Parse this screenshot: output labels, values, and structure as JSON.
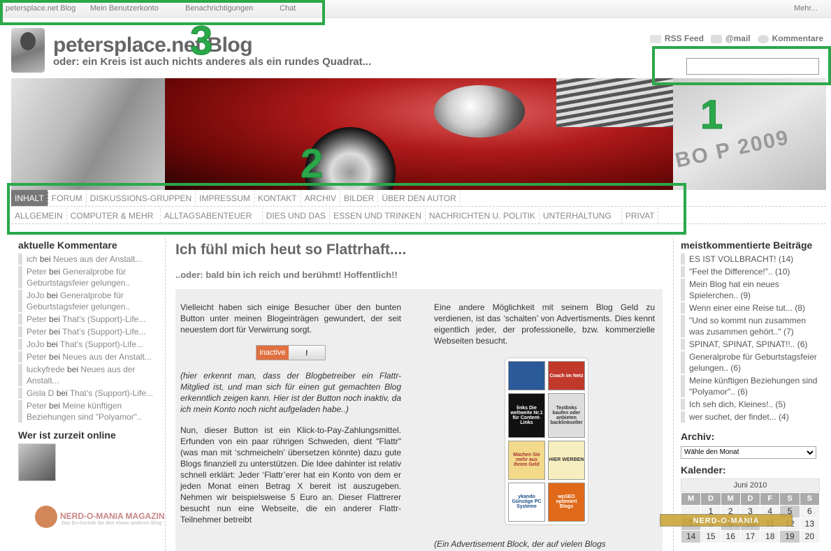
{
  "topbar": {
    "blog_link": "petersplace.net Blog",
    "account": "Mein Benutzerkonto",
    "notifications": "Benachrichtigungen",
    "chat": "Chat",
    "more": "Mehr..."
  },
  "header": {
    "title": "petersplace.net Blog",
    "tagline": "oder: ein Kreis ist auch nichts anderes als ein rundes Quadrat...",
    "rss": "RSS Feed",
    "mail": "@mail",
    "comments": "Kommentare",
    "search_value": ""
  },
  "banner": {
    "plate": "BO P 2009"
  },
  "nav_main": [
    "INHALT",
    "FORUM",
    "DISKUSSIONS-GRUPPEN",
    "IMPRESSUM",
    "KONTAKT",
    "ARCHIV",
    "BILDER",
    "ÜBER DEN AUTOR"
  ],
  "nav_categories": [
    "ALLGEMEIN",
    "COMPUTER & MEHR",
    "ALLTAGSABENTEUER",
    "DIES UND DAS",
    "ESSEN UND TRINKEN",
    "NACHRICHTEN U. POLITIK",
    "UNTERHALTUNG",
    "PRIVAT"
  ],
  "left_sidebar": {
    "heading": "aktuelle Kommentare",
    "comments": [
      {
        "author": "ich",
        "by": "bei",
        "post": "Neues aus der Anstalt..."
      },
      {
        "author": "Peter",
        "by": "bei",
        "post": "Generalprobe für Geburtstagsfeier gelungen.."
      },
      {
        "author": "JoJo",
        "by": "bei",
        "post": "Generalprobe für Geburtstagsfeier gelungen.."
      },
      {
        "author": "Peter",
        "by": "bei",
        "post": "That’s (Support)-Life..."
      },
      {
        "author": "Peter",
        "by": "bei",
        "post": "That’s (Support)-Life..."
      },
      {
        "author": "JoJo",
        "by": "bei",
        "post": "That’s (Support)-Life..."
      },
      {
        "author": "Peter",
        "by": "bei",
        "post": "Neues aus der Anstalt..."
      },
      {
        "author": "luckyfrede",
        "by": "bei",
        "post": "Neues aus der Anstalt..."
      },
      {
        "author": "Gisla D",
        "by": "bei",
        "post": "That’s (Support)-Life..."
      },
      {
        "author": "Peter",
        "by": "bei",
        "post": "Meine künftigen Beziehungen sind \"Polyamor\".."
      }
    ],
    "online_heading": "Wer ist zurzeit online",
    "nerd_logo": "NERD-O-MANIA MAGAZIN",
    "nerd_sub": "Das Ex-Gerede für den etwas anderen Blog"
  },
  "post": {
    "title": "Ich fühl mich heut so Flattrhaft....",
    "subtitle": "..oder: bald bin ich reich und berühmt! Hoffentlich!!",
    "p1": "Vielleicht haben sich einige Besucher über den bunten Button unter meinen Blogeinträgen gewundert, der seit neuestem dort für Verwirrung sorgt.",
    "flattr_label": "inactive",
    "flattr_mark": "!",
    "p2": "(hier erkennt man, dass der Blogbetreiber ein Flattr-Mitglied ist, und man sich für einen gut gemachten Blog erkenntlich zeigen kann. Hier ist der Button noch inaktiv, da ich mein Konto noch nicht aufgeladen habe..)",
    "p3": "Nun, dieser Button ist ein Klick-to-Pay-Zahlungsmittel. Erfunden von ein paar rührigen Schweden, dient \"Flattr\" (was man mit ‘schmeicheln’ übersetzen könnte) dazu gute Blogs finanziell zu unterstützen. Die Idee dahinter ist relativ schnell erklärt: Jeder ‘Flattr’erer hat ein Konto von dem er jeden Monat einen Betrag X bereit ist auszugeben. Nehmen wir beispielsweise 5 Euro an. Dieser Flattrerer besucht nun eine Webseite, die ein anderer Flattr-Teilnehmer betreibt",
    "p4": "Eine andere Möglichkeit mit seinem Blog Geld zu verdienen, ist das ‘schalten’ von Advertisments. Dies kennt eigentlich jeder, der professionelle, bzw. kommerzielle Webseiten besucht.",
    "caption": "(Ein Advertisement Block, der auf vielen Blogs",
    "ads": [
      "",
      "Coach im Netz",
      "links Die weltweite Nr.1 für Content-Links",
      "Textlinks kaufen oder anbieten backlinkseller",
      "Machen Sie mehr aus Ihrem Geld",
      "HIER WERBEN",
      "ykando Günstige PC Systeme",
      "wpSEO optimiert Blogs"
    ]
  },
  "right_sidebar": {
    "heading": "meistkommentierte Beiträge",
    "items": [
      "ES IST VOLLBRACHT! (14)",
      "\"Feel the Difference!\".. (10)",
      "Mein Blog hat ein neues Spielerchen.. (9)",
      "Wenn einer eine Reise tut... (8)",
      "\"Und so kommt nun zusammen was zusammen gehört..\" (7)",
      "SPINAT, SPINAT, SPINAT!!.. (6)",
      "Generalprobe für Geburtstagsfeier gelungen.. (6)",
      "Meine künftigen Beziehungen sind \"Polyamor\".. (6)",
      "Ich seh dich, Kleines!.. (5)",
      "wer suchet, der findet... (4)"
    ],
    "archiv_heading": "Archiv:",
    "archiv_select": "Wähle den Monat",
    "calendar_heading": "Kalender:",
    "calendar_month": "Juni 2010",
    "weekdays": [
      "M",
      "D",
      "M",
      "D",
      "F",
      "S",
      "S"
    ],
    "weeks": [
      [
        "",
        "1",
        "2",
        "3",
        "4",
        "5",
        "6"
      ],
      [
        "7",
        "8",
        "9",
        "10",
        "11",
        "12",
        "13"
      ],
      [
        "14",
        "15",
        "16",
        "17",
        "18",
        "19",
        "20"
      ]
    ],
    "nerd_banner": "NERD-O-MANIA"
  },
  "annotations": [
    "1",
    "2",
    "3"
  ]
}
